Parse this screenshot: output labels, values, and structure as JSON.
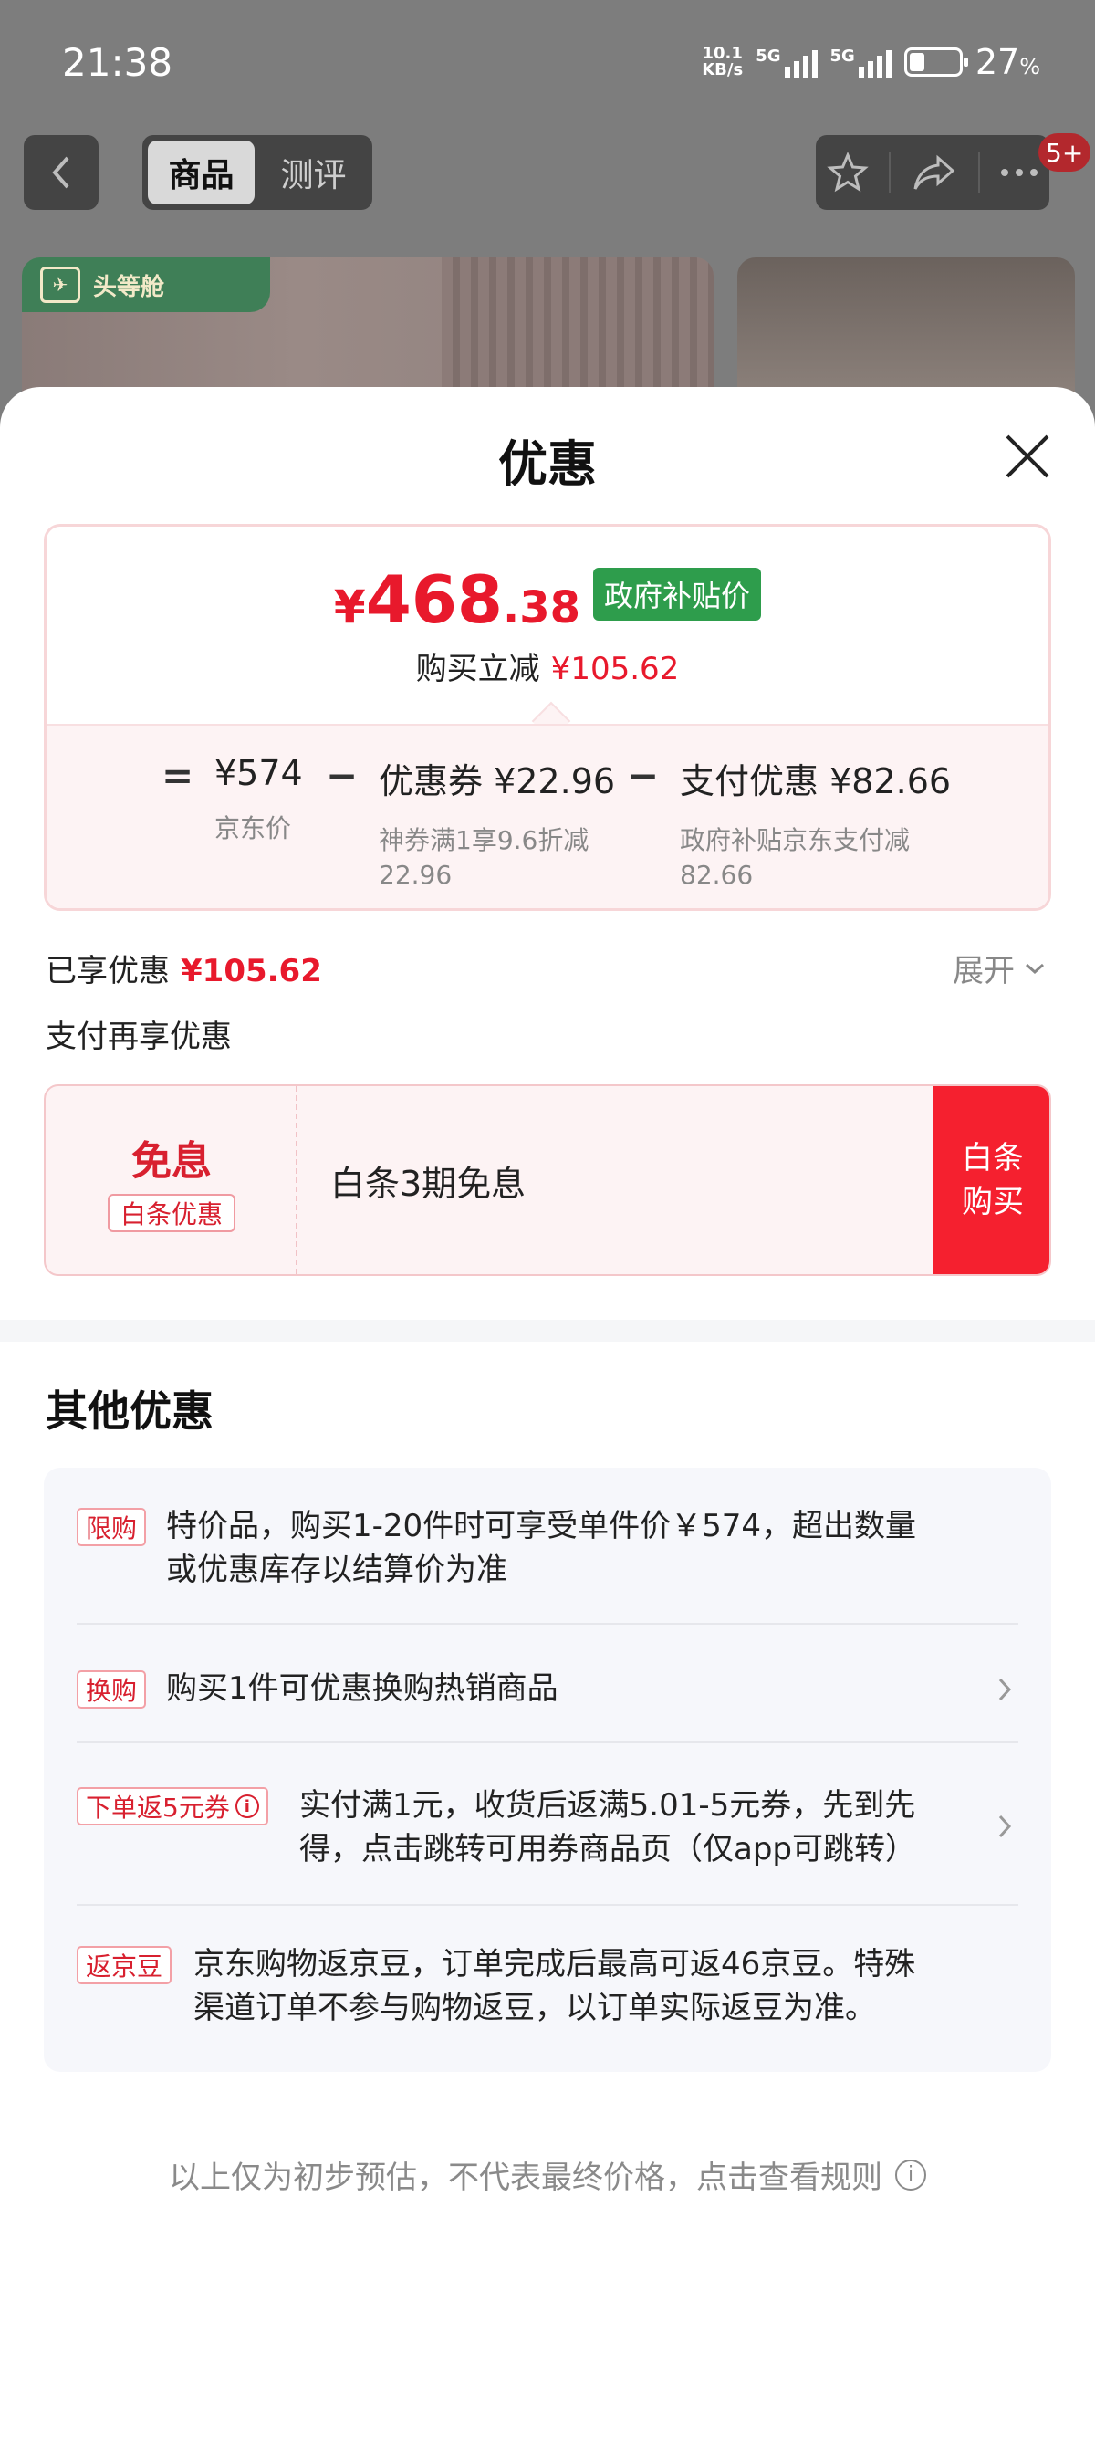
{
  "status_bar": {
    "time": "21:38",
    "net_speed_top": "10.1",
    "net_speed_bottom": "KB/s",
    "sim1": "5G",
    "sim2": "5G",
    "battery_pct": "27",
    "battery_unit": "%"
  },
  "nav": {
    "tab_product": "商品",
    "tab_review": "测评",
    "badge": "5+"
  },
  "product": {
    "tag_text": "头等舱",
    "tag_icon_text": "✈"
  },
  "sheet": {
    "title": "优惠"
  },
  "price_card": {
    "currency": "¥",
    "price_int": "468",
    "price_dec": ".38",
    "gov_tag": "政府补贴价",
    "reduce_label": "购买立减",
    "reduce_amount": "¥105.62",
    "eq": "=",
    "minus1": "−",
    "minus2": "−",
    "jd_price": "¥574",
    "jd_price_label": "京东价",
    "coupon_value": "优惠券 ¥22.96",
    "coupon_desc_1": "神券满1享9.6折减",
    "coupon_desc_2": "22.96",
    "pay_value": "支付优惠 ¥82.66",
    "pay_desc_1": "政府补贴京东支付减",
    "pay_desc_2": "82.66"
  },
  "enjoyed": {
    "label": "已享优惠",
    "amount": "¥105.62",
    "expand": "展开"
  },
  "pay_more": "支付再享优惠",
  "baitiao": {
    "big": "免息",
    "small": "白条优惠",
    "text": "白条3期免息",
    "btn": "白条\n购买"
  },
  "other": {
    "title": "其他优惠",
    "offers": [
      {
        "tag": "限购",
        "text1": "特价品，购买1-20件时可享受单件价￥574，超出数量",
        "text2": "或优惠库存以结算价为准"
      },
      {
        "tag": "换购",
        "text1": "购买1件可优惠换购热销商品"
      },
      {
        "tag": "下单返5元券",
        "text1": "实付满1元，收货后返满5.01-5元券，先到先",
        "text2": "得，点击跳转可用券商品页（仅app可跳转）"
      },
      {
        "tag": "返京豆",
        "text1": "京东购物返京豆，订单完成后最高可返46京豆。特殊",
        "text2": "渠道订单不参与购物返豆，以订单实际返豆为准。"
      }
    ]
  },
  "footnote": "以上仅为初步预估，不代表最终价格，点击查看规则",
  "colors": {
    "accent_red": "#e8192c",
    "gov_green": "#2e9d4c",
    "button_red": "#f5202f"
  }
}
